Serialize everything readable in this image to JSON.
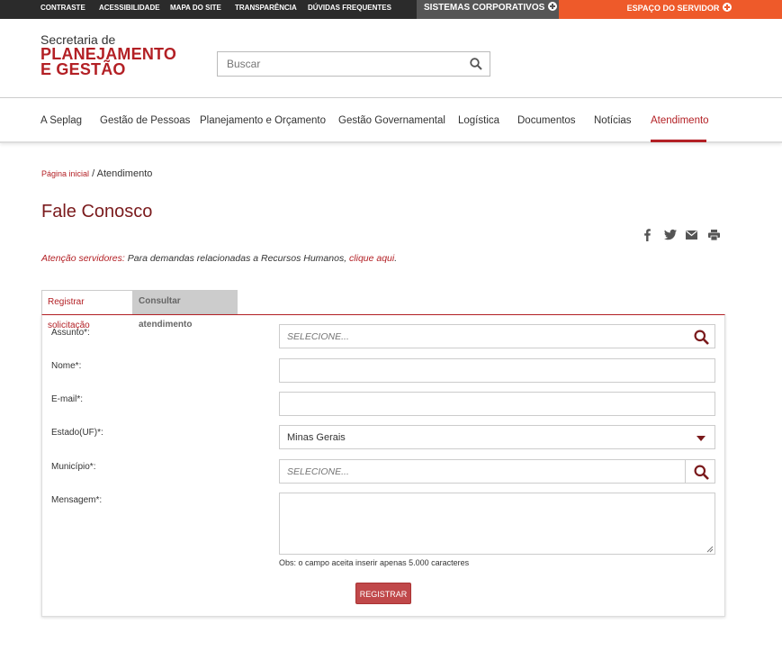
{
  "topbar": {
    "links": [
      "CONTRASTE",
      "ACESSIBILIDADE",
      "MAPA DO SITE",
      "TRANSPARÊNCIA",
      "DÚVIDAS FREQUENTES"
    ],
    "sistemas": "SISTEMAS CORPORATIVOS",
    "espaco": "ESPAÇO DO SERVIDOR"
  },
  "logo": {
    "line1": "Secretaria de",
    "line2": "PLANEJAMENTO",
    "line3": "E GESTÃO"
  },
  "search": {
    "placeholder": "Buscar"
  },
  "nav": [
    "A Seplag",
    "Gestão de Pessoas",
    "Planejamento e Orçamento",
    "Gestão Governamental",
    "Logística",
    "Documentos",
    "Notícias",
    "Atendimento"
  ],
  "breadcrumb": {
    "home": "Página inicial",
    "sep": " / ",
    "current": "Atendimento"
  },
  "page_title": "Fale Conosco",
  "notice": {
    "lead": "Atenção servidores:",
    "text": " Para demandas relacionadas a Recursos Humanos, ",
    "link": "clique aqui",
    "end": "."
  },
  "tabs": [
    "Registrar solicitação",
    "Consultar atendimento"
  ],
  "form": {
    "assunto_label": "Assunto*:",
    "assunto_placeholder": "SELECIONE...",
    "nome_label": "Nome*:",
    "email_label": "E-mail*:",
    "estado_label": "Estado(UF)*:",
    "estado_value": "Minas Gerais",
    "municipio_label": "Município*:",
    "municipio_placeholder": "SELECIONE...",
    "mensagem_label": "Mensagem*:",
    "obs": "Obs: o campo aceita inserir apenas 5.000 caracteres",
    "register": "REGISTRAR"
  },
  "colors": {
    "brand_red": "#b32025",
    "orange": "#ee5a2a",
    "topbar": "#2b2b2b"
  }
}
